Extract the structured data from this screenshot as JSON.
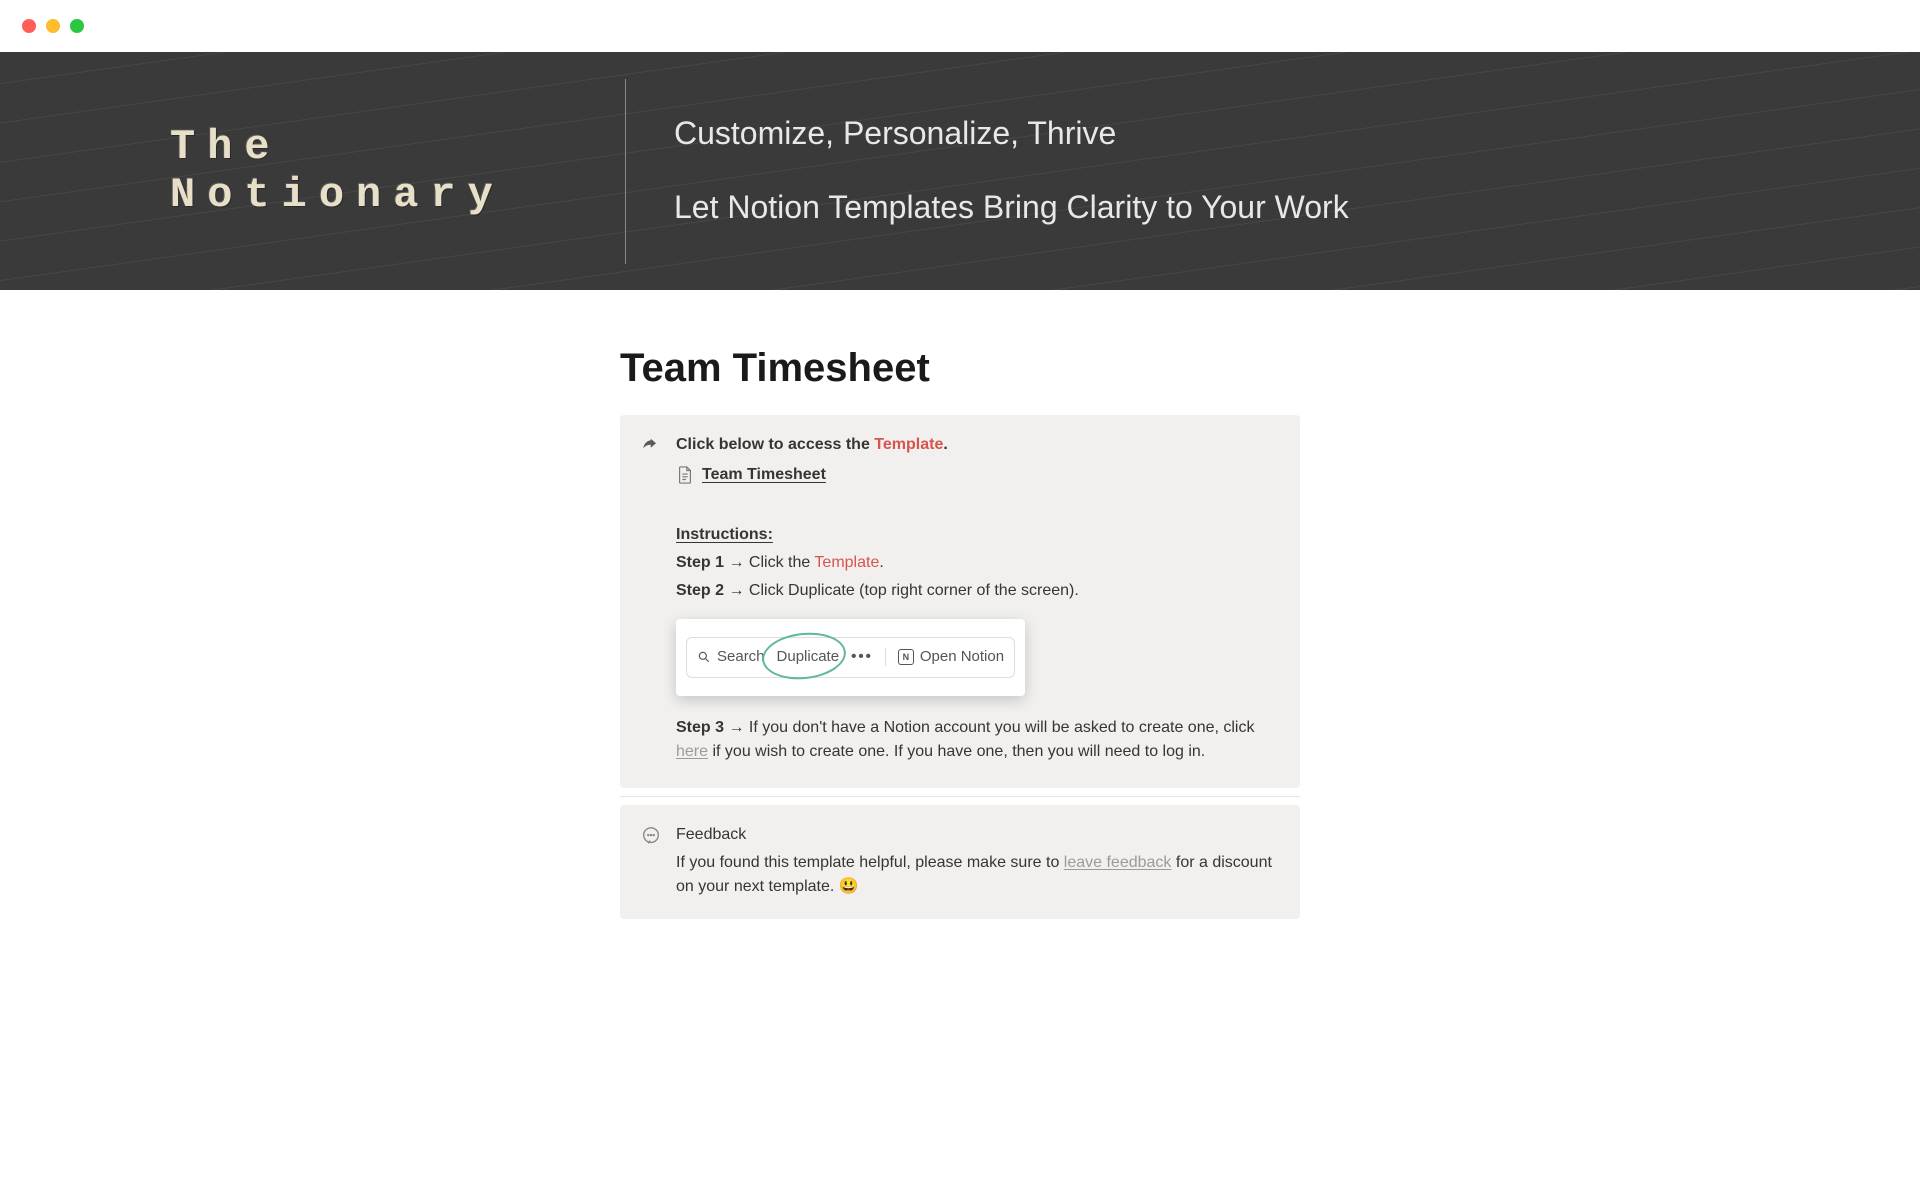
{
  "hero": {
    "brand": "The Notionary",
    "tagline1": "Customize, Personalize, Thrive",
    "tagline2": "Let Notion Templates Bring Clarity to Your Work"
  },
  "page": {
    "title": "Team Timesheet"
  },
  "callout1": {
    "prefix": "Click below to access the ",
    "template_word": "Template",
    "suffix": ".",
    "link_label": "Team Timesheet",
    "instructions_label": "Instructions:",
    "step1_label": "Step 1",
    "step1_arrow": "→",
    "step1_prefix": " Click the ",
    "step1_template": "Template",
    "step1_suffix": ".",
    "step2_label": "Step 2",
    "step2_arrow": "→",
    "step2_text": " Click Duplicate (top right corner of the screen).",
    "toolbar": {
      "search": "Search",
      "duplicate": "Duplicate",
      "open_notion": "Open Notion"
    },
    "step3_label": "Step 3",
    "step3_arrow": "→",
    "step3_prefix": " If you don't have a Notion account you will be asked to create one, click ",
    "step3_link": "here",
    "step3_suffix": " if you wish to create one. If you have one, then you will need to log in."
  },
  "feedback": {
    "title": "Feedback",
    "prefix": "If you found this template helpful, please make sure to ",
    "link": "leave feedback",
    "suffix": " for a discount on your next template. ",
    "emoji": "😃"
  }
}
